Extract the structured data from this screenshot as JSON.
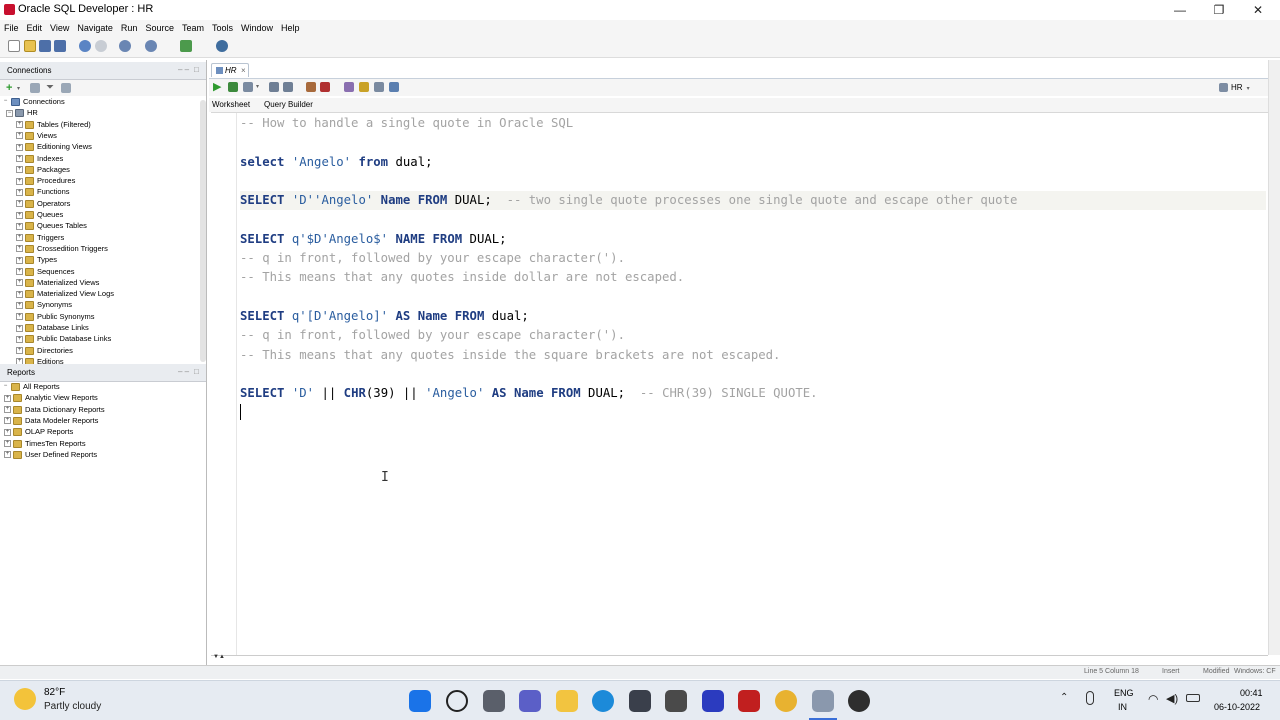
{
  "window": {
    "title": "Oracle SQL Developer : HR",
    "controls": [
      "—",
      "❐",
      "✕"
    ]
  },
  "menu": [
    "File",
    "Edit",
    "View",
    "Navigate",
    "Run",
    "Source",
    "Team",
    "Tools",
    "Window",
    "Help"
  ],
  "connections_panel": {
    "title": "Connections",
    "root": "Connections",
    "connection": "HR",
    "items": [
      "Tables (Filtered)",
      "Views",
      "Editioning Views",
      "Indexes",
      "Packages",
      "Procedures",
      "Functions",
      "Operators",
      "Queues",
      "Queues Tables",
      "Triggers",
      "Crossedition Triggers",
      "Types",
      "Sequences",
      "Materialized Views",
      "Materialized View Logs",
      "Synonyms",
      "Public Synonyms",
      "Database Links",
      "Public Database Links",
      "Directories",
      "Editions"
    ]
  },
  "reports_panel": {
    "title": "Reports",
    "root": "All Reports",
    "items": [
      "Analytic View Reports",
      "Data Dictionary Reports",
      "Data Modeler Reports",
      "OLAP Reports",
      "TimesTen Reports",
      "User Defined Reports"
    ]
  },
  "editor": {
    "tab_label": "HR",
    "connection_selector": "HR",
    "subtabs": [
      "Worksheet",
      "Query Builder"
    ],
    "lines": [
      [
        [
          "cm",
          "-- How to handle a single quote in Oracle SQL"
        ]
      ],
      [],
      [
        [
          "kw",
          "select"
        ],
        [
          "tx",
          " "
        ],
        [
          "st",
          "'Angelo'"
        ],
        [
          "tx",
          " "
        ],
        [
          "kw",
          "from"
        ],
        [
          "tx",
          " dual;"
        ]
      ],
      [],
      [
        [
          "kw",
          "SELECT"
        ],
        [
          "tx",
          " "
        ],
        [
          "st",
          "'D''Angelo'"
        ],
        [
          "tx",
          " "
        ],
        [
          "kw",
          "Name"
        ],
        [
          "tx",
          " "
        ],
        [
          "kw",
          "FROM"
        ],
        [
          "tx",
          " DUAL;  "
        ],
        [
          "cm",
          "-- two single quote processes one single quote and escape other quote"
        ]
      ],
      [],
      [
        [
          "kw",
          "SELECT"
        ],
        [
          "tx",
          " "
        ],
        [
          "st",
          "q'$D'Angelo$'"
        ],
        [
          "tx",
          " "
        ],
        [
          "kw",
          "NAME"
        ],
        [
          "tx",
          " "
        ],
        [
          "kw",
          "FROM"
        ],
        [
          "tx",
          " DUAL;"
        ]
      ],
      [
        [
          "cm",
          "-- q in front, followed by your escape character(')."
        ]
      ],
      [
        [
          "cm",
          "-- This means that any quotes inside dollar are not escaped."
        ]
      ],
      [],
      [
        [
          "kw",
          "SELECT"
        ],
        [
          "tx",
          " "
        ],
        [
          "st",
          "q'[D'Angelo]'"
        ],
        [
          "tx",
          " "
        ],
        [
          "kw",
          "AS"
        ],
        [
          "tx",
          " "
        ],
        [
          "kw",
          "Name"
        ],
        [
          "tx",
          " "
        ],
        [
          "kw",
          "FROM"
        ],
        [
          "tx",
          " dual;"
        ]
      ],
      [
        [
          "cm",
          "-- q in front, followed by your escape character(')."
        ]
      ],
      [
        [
          "cm",
          "-- This means that any quotes inside the square brackets are not escaped."
        ]
      ],
      [],
      [
        [
          "kw",
          "SELECT"
        ],
        [
          "tx",
          " "
        ],
        [
          "st",
          "'D'"
        ],
        [
          "tx",
          " || "
        ],
        [
          "kw",
          "CHR"
        ],
        [
          "tx",
          "(39) || "
        ],
        [
          "st",
          "'Angelo'"
        ],
        [
          "tx",
          " "
        ],
        [
          "kw",
          "AS"
        ],
        [
          "tx",
          " "
        ],
        [
          "kw",
          "Name"
        ],
        [
          "tx",
          " "
        ],
        [
          "kw",
          "FROM"
        ],
        [
          "tx",
          " DUAL;  "
        ],
        [
          "cm",
          "-- CHR(39) SINGLE QUOTE."
        ]
      ],
      []
    ]
  },
  "statusbar": {
    "position": "Line 5 Column 18",
    "mode": "Insert",
    "state": "Modified",
    "platform": "Windows: CF"
  },
  "taskbar": {
    "weather_temp": "82°F",
    "weather_desc": "Partly cloudy",
    "lang_1": "ENG",
    "lang_2": "IN",
    "time": "00:41",
    "date": "06-10-2022"
  },
  "colors": {
    "keyword": "#1f3d82",
    "string": "#2a5d9f",
    "comment": "#a3a3a3"
  }
}
